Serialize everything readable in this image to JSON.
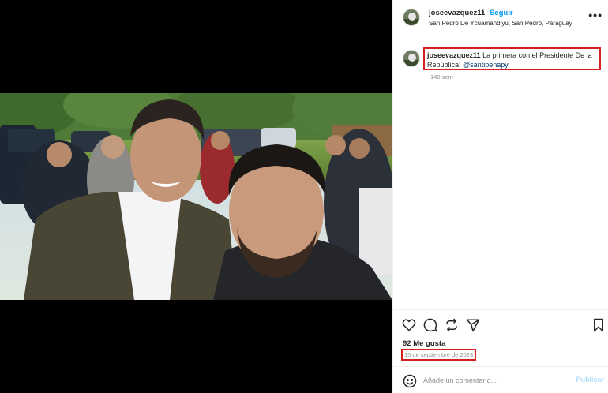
{
  "post": {
    "username": "joseevazquez11",
    "separator": "•",
    "follow_label": "Seguir",
    "location": "San Pedro De Ycuamandiyú, San Pedro, Paraguay",
    "more_icon": "more-options-icon"
  },
  "caption": {
    "username": "joseevazquez11",
    "text": "La primera con el Presidente De la República!",
    "mention": "@santipenapy",
    "time": "140 sem"
  },
  "engagement": {
    "likes": "92 Me gusta",
    "date": "15 de septiembre de 2023"
  },
  "comment": {
    "placeholder": "Añade un comentario...",
    "publish_label": "Publicar"
  },
  "icons": [
    "heart-icon",
    "comment-icon",
    "share-icon",
    "send-icon",
    "bookmark-icon",
    "emoji-icon"
  ],
  "colors": {
    "accent": "#0095f6",
    "highlight_box": "#d81e1e",
    "mention": "#00376b",
    "publish_disabled": "#b2dffc"
  }
}
